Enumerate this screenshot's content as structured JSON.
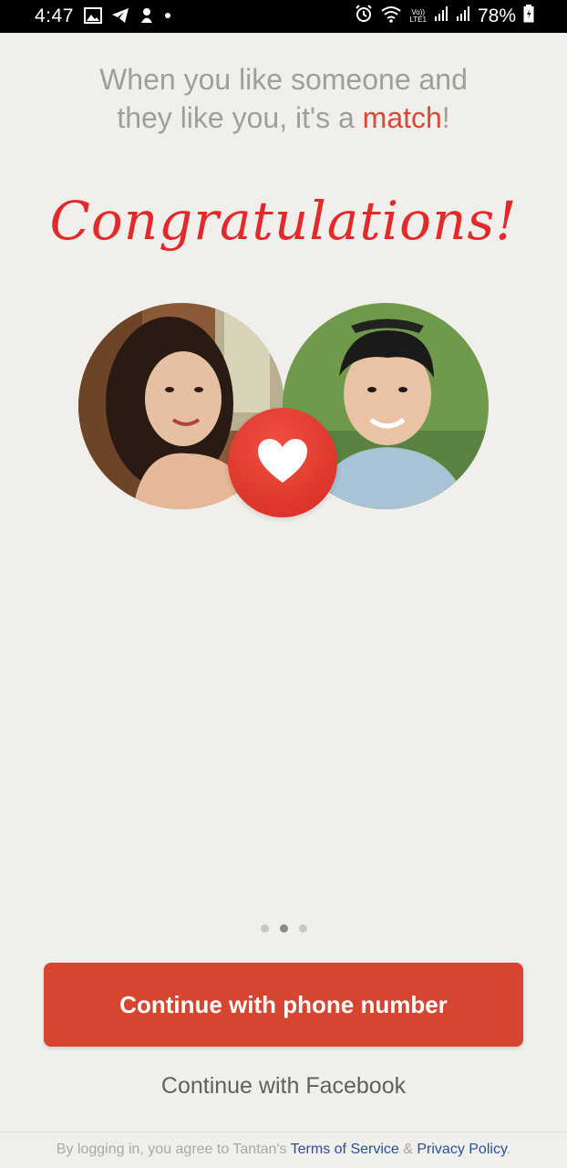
{
  "status_bar": {
    "time": "4:47",
    "battery": "78%",
    "network_top": "Vo))",
    "network_bottom": "LTE1",
    "icons": [
      "gallery-icon",
      "telegram-icon",
      "app-icon",
      "dot-icon",
      "alarm-icon",
      "wifi-icon",
      "signal-icon",
      "signal-icon",
      "battery-icon"
    ]
  },
  "headline": {
    "line1": "When you like someone and",
    "line2_prefix": "they like you, it's a ",
    "line2_highlight": "match",
    "line2_suffix": "!"
  },
  "congrats": "Congratulations!",
  "pager": {
    "count": 3,
    "active_index": 1
  },
  "actions": {
    "phone_label": "Continue with phone number",
    "facebook_label": "Continue with Facebook"
  },
  "legal": {
    "prefix": "By logging in, you agree to Tantan's ",
    "terms": "Terms of Service",
    "and": " & ",
    "privacy": "Privacy Policy",
    "suffix": "."
  },
  "colors": {
    "brand_red": "#d6452f",
    "heart_red": "#e22a2b",
    "link_blue": "#2a4f94",
    "background": "#f1efeb"
  }
}
